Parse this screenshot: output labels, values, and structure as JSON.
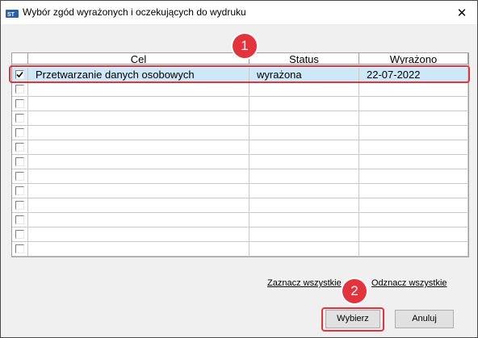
{
  "window": {
    "title": "Wybór zgód wyrażonych i oczekujących do wydruku",
    "close_glyph": "✕"
  },
  "grid": {
    "columns": [
      "",
      "Cel",
      "Status",
      "Wyrażono"
    ],
    "rows": [
      {
        "checked": true,
        "cel": "Przetwarzanie danych osobowych",
        "status": "wyrażona",
        "wyrazono": "22-07-2022"
      },
      {
        "checked": false,
        "cel": "",
        "status": "",
        "wyrazono": ""
      },
      {
        "checked": false,
        "cel": "",
        "status": "",
        "wyrazono": ""
      },
      {
        "checked": false,
        "cel": "",
        "status": "",
        "wyrazono": ""
      },
      {
        "checked": false,
        "cel": "",
        "status": "",
        "wyrazono": ""
      },
      {
        "checked": false,
        "cel": "",
        "status": "",
        "wyrazono": ""
      },
      {
        "checked": false,
        "cel": "",
        "status": "",
        "wyrazono": ""
      },
      {
        "checked": false,
        "cel": "",
        "status": "",
        "wyrazono": ""
      },
      {
        "checked": false,
        "cel": "",
        "status": "",
        "wyrazono": ""
      },
      {
        "checked": false,
        "cel": "",
        "status": "",
        "wyrazono": ""
      },
      {
        "checked": false,
        "cel": "",
        "status": "",
        "wyrazono": ""
      },
      {
        "checked": false,
        "cel": "",
        "status": "",
        "wyrazono": ""
      },
      {
        "checked": false,
        "cel": "",
        "status": "",
        "wyrazono": ""
      }
    ]
  },
  "links": {
    "select_all": "Zaznacz wszystkie",
    "deselect_all": "Odznacz wszystkie"
  },
  "buttons": {
    "choose": "Wybierz",
    "cancel": "Anuluj"
  },
  "annotations": {
    "step1": "1",
    "step2": "2"
  },
  "colors": {
    "highlight": "#e3343d",
    "selected_row": "#cde8f6"
  },
  "icons": {
    "app": "app-logo-icon",
    "close": "close-icon",
    "check": "checkmark-icon"
  }
}
